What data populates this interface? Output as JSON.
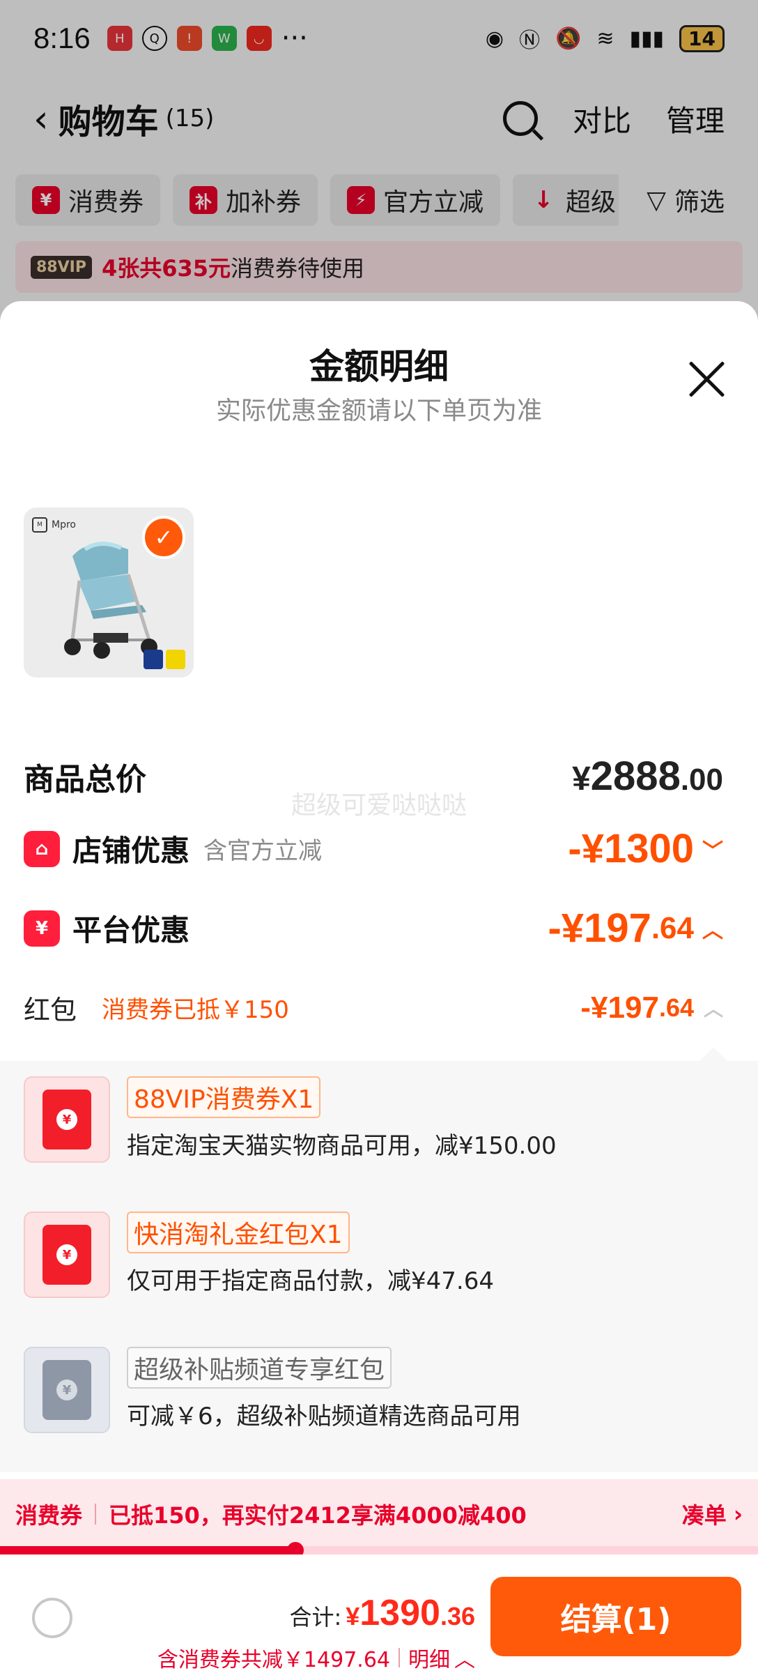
{
  "status_bar": {
    "time": "8:16",
    "more": "···",
    "battery": "14"
  },
  "nav": {
    "back_icon": "back-arrow-icon",
    "title": "购物车",
    "count": "(15)",
    "compare": "对比",
    "manage": "管理"
  },
  "filters": {
    "chips": [
      {
        "icon": "¥",
        "label": "消费券"
      },
      {
        "icon": "补",
        "label": "加补券"
      },
      {
        "icon": "⚡",
        "label": "官方立减"
      },
      {
        "icon": "↓",
        "label": "超级"
      }
    ],
    "filter_label": "筛选"
  },
  "vip_banner": {
    "tag": "88VIP",
    "highlight": "4张共635元",
    "text": "消费券待使用"
  },
  "sheet": {
    "title": "金额明细",
    "subtitle": "实际优惠金额请以下单页为准",
    "watermark": "超级可爱哒哒哒",
    "product": {
      "brand": "Mpro",
      "selected": true
    },
    "total": {
      "label": "商品总价",
      "currency": "¥",
      "integer": "2888",
      "decimal": ".00"
    },
    "shop_discount": {
      "label": "店铺优惠",
      "note": "含官方立减",
      "value": "-¥1300",
      "expanded": false
    },
    "platform_discount": {
      "label": "平台优惠",
      "integer": "-¥197",
      "decimal": ".64",
      "expanded": true
    },
    "red_packet": {
      "label": "红包",
      "note": "消费券已抵￥150",
      "integer": "-¥197",
      "decimal": ".64"
    },
    "coupons": [
      {
        "tag": "88VIP消费券X1",
        "desc": "指定淘宝天猫实物商品可用，减¥150.00",
        "style": "red"
      },
      {
        "tag": "快消淘礼金红包X1",
        "desc": "仅可用于指定商品付款，减¥47.64",
        "style": "red"
      },
      {
        "tag": "超级补贴频道专享红包",
        "desc": "可减￥6，超级补贴频道精选商品可用",
        "style": "gray"
      }
    ]
  },
  "voucher_bar": {
    "label": "消费券",
    "message": "已抵150，再实付2412享满4000减400",
    "link": "凑单",
    "progress": 0.39
  },
  "footer": {
    "total_label": "合计:",
    "currency": "¥",
    "integer": "1390",
    "decimal": ".36",
    "savings": "含消费券共减￥1497.64",
    "detail": "明细",
    "checkout": "结算(1)"
  },
  "colors": {
    "accent_orange": "#ff5000",
    "accent_red": "#e8002a",
    "checkout": "#ff5a0a"
  }
}
